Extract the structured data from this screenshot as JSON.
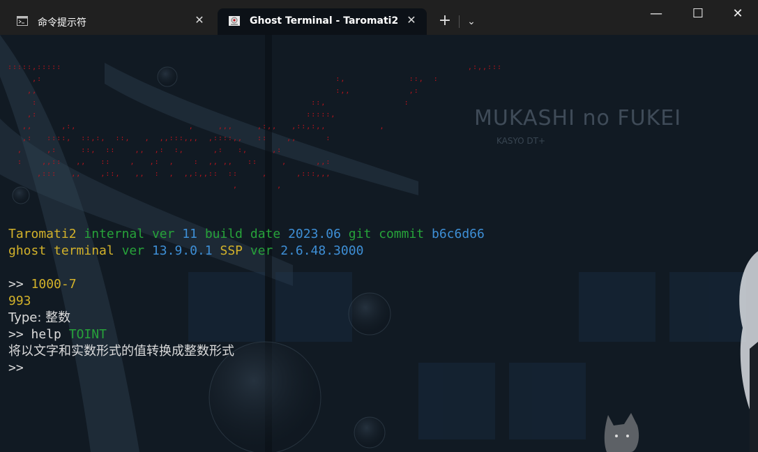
{
  "tabs": [
    {
      "title": "命令提示符",
      "icon": "command-prompt-icon"
    },
    {
      "title": "Ghost Terminal - Taromati2",
      "icon": "ghost-app-icon"
    }
  ],
  "window_controls": {
    "minimize": "—",
    "maximize": "☐",
    "close": "✕"
  },
  "tab_controls": {
    "new_tab": "+",
    "dropdown": "⌄",
    "tab_close": "✕"
  },
  "watermark": {
    "title": "MUKASHI no FUKEI",
    "subtitle": "KASYO DT+"
  },
  "ascii_logo": ":::::,:::::                                                                                   ,:,,:::\n     ,:                                                            :,             ::,  :\n    ,,                                                             :,,            ,:\n     :                                                        ::,                :\n    ,:                                                       :::::,\n   ,,      ,:,                       ,     ,,,     ,:,,   ,::,:,,           ,\n   ,:   ::::,  ::,:,  ::,   ,  ,,:::,,,  ,::::,,   ::    ,,      :\n  ,     ,:     ::,  ::    ,,  ,:  :,      ,:   :,     ,:\n  :    ,,::   ,,   ::    ,   ,:  ,    :  ,, ,,   ::     ,      ,,:\n      ,:::   ,,    ,::,   ,,  :  ,  ,,:,,::  ::     ,      ,:::,,,\n                                              ,        ,",
  "terminal": {
    "info1": {
      "name": "Taromati2",
      "internal": "internal",
      "ver_kw": "ver",
      "ver": "11",
      "build_kw": "build",
      "date_kw": "date",
      "date": "2023.06",
      "git_kw": "git",
      "commit_kw": "commit",
      "commit": "b6c6d66"
    },
    "info2": {
      "ghost": "ghost",
      "terminal": "terminal",
      "ver_kw": "ver",
      "ver": "13.9.0.1",
      "ssp": "SSP",
      "ssp_ver_kw": "ver",
      "ssp_ver": "2.6.48.3000"
    },
    "prompt": ">>",
    "cmd1": "1000-7",
    "result": "993",
    "type_label": "Type:",
    "type_value": "整数",
    "cmd2_kw": "help",
    "cmd2_arg": "TOINT",
    "help_text": "将以文字和实数形式的值转换成整数形式"
  }
}
